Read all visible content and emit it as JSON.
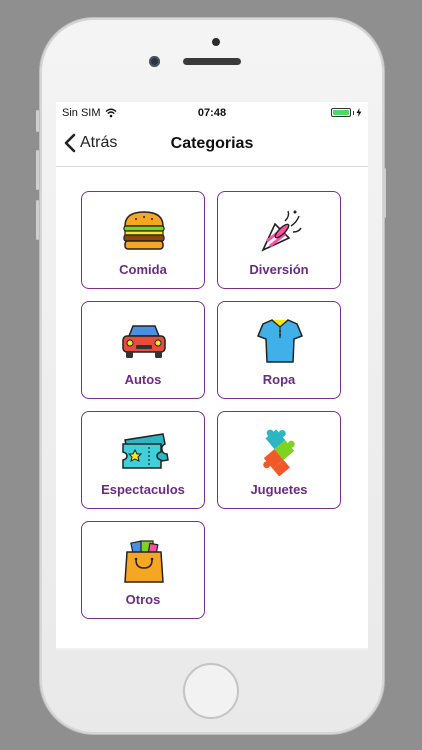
{
  "status_bar": {
    "carrier": "Sin SIM",
    "time": "07:48",
    "battery_color": "#4cd964"
  },
  "nav": {
    "back_label": "Atrás",
    "title": "Categorias"
  },
  "categories": [
    {
      "label": "Comida",
      "icon": "burger-icon"
    },
    {
      "label": "Diversión",
      "icon": "party-popper-icon"
    },
    {
      "label": "Autos",
      "icon": "car-icon"
    },
    {
      "label": "Ropa",
      "icon": "shirt-icon"
    },
    {
      "label": "Espectaculos",
      "icon": "ticket-icon"
    },
    {
      "label": "Juguetes",
      "icon": "puzzle-icon"
    },
    {
      "label": "Otros",
      "icon": "shopping-bag-icon"
    }
  ],
  "colors": {
    "accent": "#6d2a86",
    "tile_border": "#7b2f8e"
  }
}
